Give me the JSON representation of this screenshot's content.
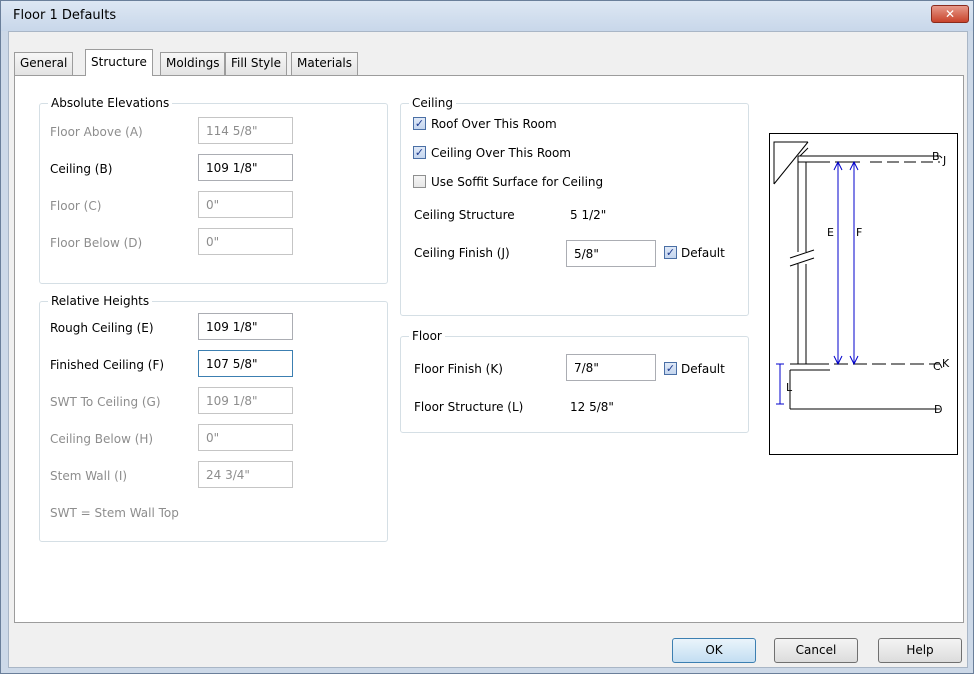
{
  "window": {
    "title": "Floor 1 Defaults",
    "close_glyph": "✕"
  },
  "tabs": [
    {
      "label": "General"
    },
    {
      "label": "Structure"
    },
    {
      "label": "Moldings"
    },
    {
      "label": "Fill Style"
    },
    {
      "label": "Materials"
    }
  ],
  "active_tab": "Structure",
  "absolute_elevations": {
    "label": "Absolute Elevations",
    "floor_above": {
      "label": "Floor Above (A)",
      "value": "114 5/8\""
    },
    "ceiling": {
      "label": "Ceiling (B)",
      "value": "109 1/8\""
    },
    "floor": {
      "label": "Floor (C)",
      "value": "0\""
    },
    "floor_below": {
      "label": "Floor Below (D)",
      "value": "0\""
    }
  },
  "relative_heights": {
    "label": "Relative Heights",
    "rough_ceiling": {
      "label": "Rough Ceiling (E)",
      "value": "109 1/8\""
    },
    "finished_ceiling": {
      "label": "Finished Ceiling (F)",
      "value": "107 5/8\""
    },
    "swt_to_ceiling": {
      "label": "SWT To Ceiling (G)",
      "value": "109 1/8\""
    },
    "ceiling_below": {
      "label": "Ceiling Below (H)",
      "value": "0\""
    },
    "stem_wall": {
      "label": "Stem Wall (I)",
      "value": "24 3/4\""
    },
    "note": "SWT = Stem Wall Top"
  },
  "ceiling": {
    "label": "Ceiling",
    "roof_over_room": {
      "label": "Roof Over This Room",
      "checked": true
    },
    "ceiling_over_room": {
      "label": "Ceiling Over This Room",
      "checked": true
    },
    "use_soffit": {
      "label": "Use Soffit Surface for Ceiling",
      "checked": false
    },
    "structure": {
      "label": "Ceiling Structure",
      "value": "5 1/2\""
    },
    "finish": {
      "label": "Ceiling Finish (J)",
      "value": "5/8\"",
      "default_label": "Default",
      "default_checked": true
    }
  },
  "floor": {
    "label": "Floor",
    "finish": {
      "label": "Floor Finish (K)",
      "value": "7/8\"",
      "default_label": "Default",
      "default_checked": true
    },
    "structure": {
      "label": "Floor Structure (L)",
      "value": "12 5/8\""
    }
  },
  "preview": {
    "labels": {
      "b": "B",
      "j": "J",
      "e": "E",
      "f": "F",
      "c": "C",
      "k": "K",
      "l": "L",
      "d": "D"
    },
    "dim_color": "#0000cc"
  },
  "buttons": {
    "ok": "OK",
    "cancel": "Cancel",
    "help": "Help"
  },
  "check_glyph": "✓"
}
